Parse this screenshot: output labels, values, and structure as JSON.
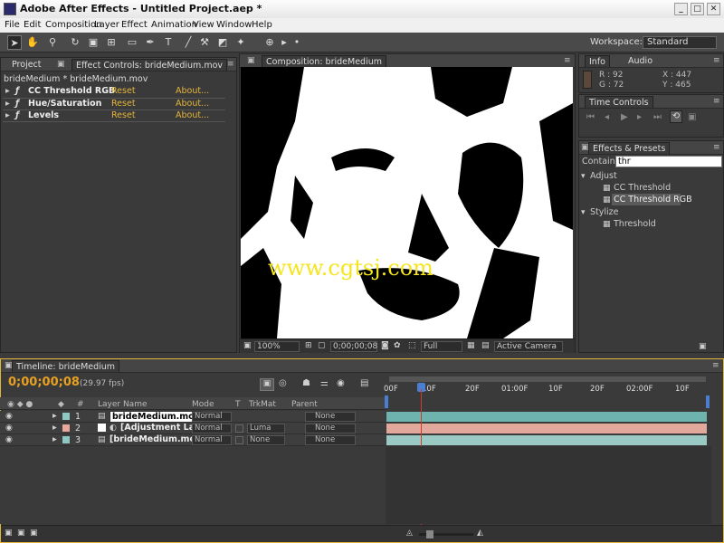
{
  "app": {
    "title": "Adobe After Effects - Untitled Project.aep *"
  },
  "window_controls": {
    "minimize": "_",
    "maximize": "□",
    "close": "✕"
  },
  "menu": [
    "File",
    "Edit",
    "Composition",
    "Layer",
    "Effect",
    "Animation",
    "View",
    "Window",
    "Help"
  ],
  "toolbar": {
    "tools": [
      "selection-tool",
      "hand-tool",
      "zoom-tool",
      "rotation-tool",
      "camera-tool",
      "pan-behind-tool",
      "rectangle-mask-tool",
      "pen-tool",
      "text-tool",
      "brush-tool",
      "clone-stamp-tool",
      "eraser-tool",
      "puppet-pin-tool"
    ],
    "workspace_label": "Workspace:",
    "workspace_value": "Standard"
  },
  "project_panel": {
    "tab": "Project",
    "fx_tab": "Effect Controls: brideMedium.mov",
    "breadcrumb": "brideMedium * brideMedium.mov"
  },
  "effects": [
    {
      "name": "CC Threshold RGB",
      "reset": "Reset",
      "about": "About..."
    },
    {
      "name": "Hue/Saturation",
      "reset": "Reset",
      "about": "About..."
    },
    {
      "name": "Levels",
      "reset": "Reset",
      "about": "About..."
    }
  ],
  "composition": {
    "tab": "Composition: brideMedium",
    "watermark": "www.cgtsj.com",
    "zoom": "100%",
    "timecode": "0;00;00;08",
    "resolution": "Full",
    "camera": "Active Camera"
  },
  "info_panel": {
    "tab_info": "Info",
    "tab_audio": "Audio",
    "r": "R : 92",
    "g": "G : 72",
    "x": "X : 447",
    "y": "Y : 465",
    "swatch_color": "#5c4838"
  },
  "time_controls": {
    "tab": "Time Controls",
    "buttons": [
      "first-frame",
      "prev-frame",
      "play",
      "next-frame",
      "last-frame",
      "audio",
      "loop",
      "ram-preview"
    ]
  },
  "effects_presets": {
    "tab": "Effects & Presets",
    "contains_label": "Contains:",
    "search_value": "thr",
    "groups": [
      {
        "name": "Adjust",
        "items": [
          "CC Threshold",
          "CC Threshold RGB"
        ]
      },
      {
        "name": "Stylize",
        "items": [
          "Threshold"
        ]
      }
    ],
    "selected": "CC Threshold RGB"
  },
  "timeline": {
    "tab": "Timeline: brideMedium",
    "timecode": "0;00;00;08",
    "fps": "(29.97 fps)",
    "columns": {
      "num": "#",
      "layer_name": "Layer Name",
      "mode": "Mode",
      "t": "T",
      "trkmat": "TrkMat",
      "parent": "Parent"
    },
    "ruler": [
      "00F",
      "10F",
      "20F",
      "01:00F",
      "10F",
      "20F",
      "02:00F",
      "10F"
    ],
    "layers": [
      {
        "num": "1",
        "name": "brideMe​dium.mov",
        "mode": "Normal",
        "trkmat": "",
        "parent": "None",
        "color": "#8fc7c2",
        "bar": "#6fb3ae"
      },
      {
        "num": "2",
        "name": "[Adjustment La",
        "mode": "Normal",
        "trkmat": "Luma",
        "parent": "None",
        "color": "#e8a89a",
        "bar": "#e1a89b"
      },
      {
        "num": "3",
        "name": "[brideMedium.mov",
        "mode": "Normal",
        "trkmat": "None",
        "parent": "None",
        "color": "#8fc7c2",
        "bar": "#9bc9c4"
      }
    ]
  },
  "colors": {
    "accent": "#e3b53a",
    "timecode": "#e8a020",
    "playhead": "#d23a2a"
  }
}
